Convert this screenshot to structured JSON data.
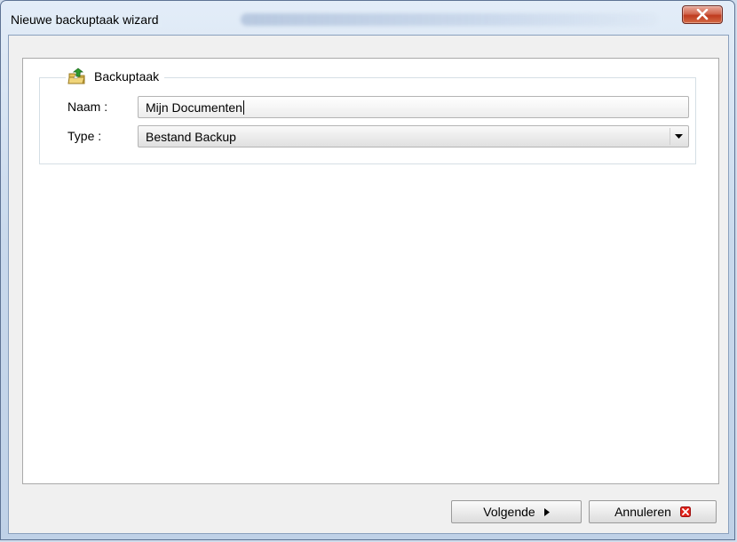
{
  "window": {
    "title": "Nieuwe backuptaak wizard"
  },
  "group": {
    "legend": "Backuptaak",
    "icon": "folder-upload-icon"
  },
  "form": {
    "name_label": "Naam :",
    "name_value": "Mijn Documenten",
    "type_label": "Type :",
    "type_value": "Bestand Backup"
  },
  "buttons": {
    "next_label": "Volgende",
    "cancel_label": "Annuleren"
  },
  "colors": {
    "close_button": "#c8452a",
    "cancel_icon": "#e0231a",
    "folder_icon": "#e4c45a",
    "arrow_green": "#2e9b2e"
  }
}
